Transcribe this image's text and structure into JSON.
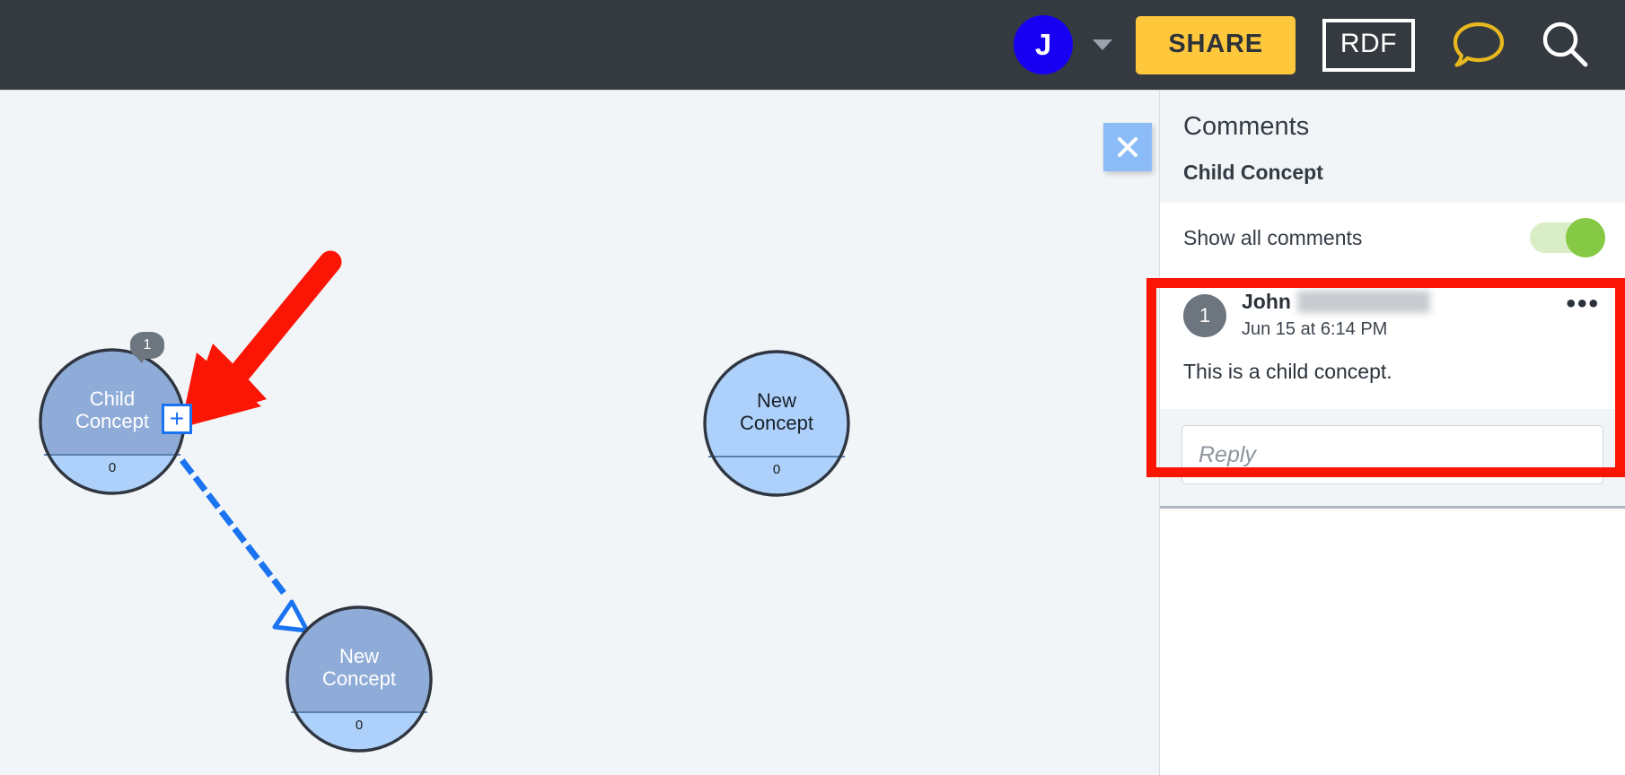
{
  "topbar": {
    "avatar_initial": "J",
    "avatar_color": "#1800f2",
    "caret_icon": "chevron-down-icon",
    "share_label": "SHARE",
    "share_color": "#ffc83c",
    "rdf_label": "RDF",
    "comments_icon": "speech-bubble-icon",
    "comments_icon_color": "#e8b81e",
    "search_icon": "search-icon",
    "search_icon_color": "#ffffff",
    "background": "#343a40"
  },
  "canvas": {
    "background": "#f2f5f8",
    "close_icon": "close-icon",
    "annotation_arrow": {
      "icon": "red-arrow-annotation",
      "color": "#fa1505"
    },
    "nodes": [
      {
        "id": "child-concept",
        "label": "Child\nConcept",
        "count": "0",
        "badge": "1",
        "state": "selected",
        "fill": "#8fabd8",
        "sub_fill": "#aed1fb",
        "plus_handle": "+"
      },
      {
        "id": "new-concept-right",
        "label": "New\nConcept",
        "count": "0",
        "state": "plain",
        "fill": "#aed1fb",
        "sub_fill": "#aed1fb"
      },
      {
        "id": "new-concept-bottom",
        "label": "New\nConcept",
        "count": "0",
        "state": "selected",
        "fill": "#8fabd8",
        "sub_fill": "#aed1fb"
      }
    ],
    "link": {
      "style": "dashed",
      "color": "#1a73f0",
      "arrowhead": "hollow-triangle",
      "from": "child-concept",
      "to": "new-concept-bottom"
    }
  },
  "comments_panel": {
    "title": "Comments",
    "subject": "Child Concept",
    "show_all_label": "Show all comments",
    "show_all_enabled": true,
    "toggle_on_color": "#85c944",
    "toggle_track_color": "#d9edc6",
    "comments": [
      {
        "avatar_initial": "1",
        "author": "John",
        "author_redacted": true,
        "timestamp": "Jun 15 at 6:14 PM",
        "body": "This is a child concept.",
        "menu_icon": "more-options-icon"
      }
    ],
    "reply_placeholder": "Reply",
    "reply_value": ""
  },
  "annotations": {
    "highlight_box_color": "#fa1505"
  }
}
